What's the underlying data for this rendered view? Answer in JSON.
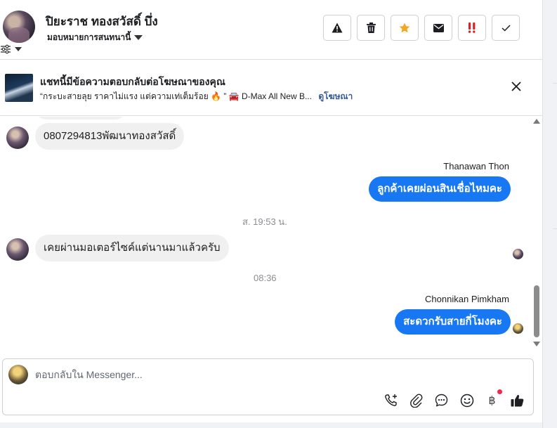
{
  "header": {
    "contact_name": "ปิยะราช ทองสวัสดิ์ บึ่ง",
    "assign_label": "มอบหมายการสนทนานี้",
    "actions": [
      {
        "name": "spam-button",
        "icon": "warning-icon"
      },
      {
        "name": "delete-button",
        "icon": "trash-icon"
      },
      {
        "name": "star-button",
        "icon": "star-icon",
        "color": "#f5a623"
      },
      {
        "name": "mark-unread-button",
        "icon": "envelope-icon"
      },
      {
        "name": "follow-up-button",
        "icon": "exclamation-icon",
        "color": "#e02020"
      },
      {
        "name": "mark-done-button",
        "icon": "check-icon"
      }
    ]
  },
  "ad_banner": {
    "title": "แชทนี้มีข้อความตอบกลับต่อโฆษณาของคุณ",
    "quote": "“กระบะสายลุย ราคาไม่แรง แต่ความเท่เต็มร้อย 🔥 ” 🚘 D-Max All New B...",
    "link": "ดูโฆษณา"
  },
  "messages": {
    "in_1": "0807294813พัฒนาทองสวัสดิ์",
    "sender_1": "Thanawan Thon",
    "out_1": "ลูกค้าเคยผ่อนสินเชื่อไหมคะ",
    "time_1": "ส. 19:53 น.",
    "in_2": "เคยผ่านมอเตอร์ไซค์แต่นานมาแล้วครับ",
    "time_2": "08:36",
    "sender_2": "Chonnikan Pimkham",
    "out_2": "สะดวกรับสายกี่โมงคะ"
  },
  "composer": {
    "placeholder": "ตอบกลับใน Messenger...",
    "baht_symbol": "฿",
    "tools": [
      "call-add-icon",
      "attachment-icon",
      "saved-reply-icon",
      "emoji-icon",
      "payment-icon",
      "thumbs-up-icon"
    ]
  },
  "colors": {
    "accent": "#1877f2",
    "bubble_in": "#f0f0f0",
    "star": "#f5a623",
    "alert": "#e02020"
  }
}
